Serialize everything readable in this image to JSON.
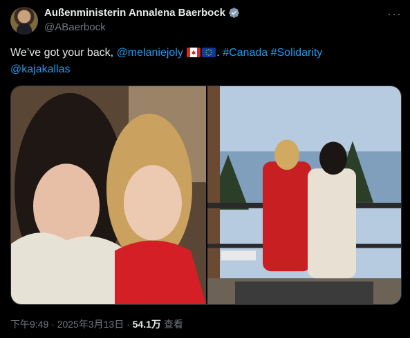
{
  "author": {
    "display_name": "Außenministerin Annalena Baerbock",
    "handle": "@ABaerbock",
    "verified": true
  },
  "tweet": {
    "text_before": "We’ve got your back, ",
    "mention_1": "@melaniejoly",
    "text_mid": ". ",
    "hashtag_1": "#Canada",
    "hashtag_2": "#Solidarity",
    "mention_2": "@kajakallas"
  },
  "meta": {
    "time": "下午9:49",
    "separator": " · ",
    "date": "2025年3月13日",
    "views": "54.1万",
    "views_label": "查看"
  },
  "icons": {
    "more": "more-options-icon",
    "verified": "verified-badge-icon",
    "flag_1": "canada-flag-emoji",
    "flag_2": "eu-flag-emoji"
  },
  "colors": {
    "link": "#1d9bf0",
    "background": "#000000",
    "text": "#e7e9ea",
    "muted": "#71767b"
  }
}
